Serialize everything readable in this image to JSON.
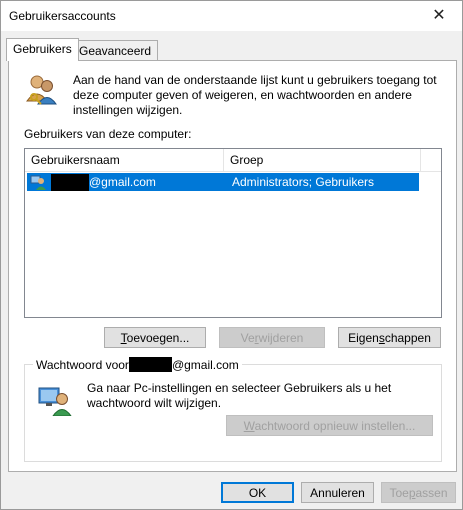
{
  "window": {
    "title": "Gebruikersaccounts",
    "close_glyph": "✕"
  },
  "tabs": [
    {
      "label": "Gebruikers",
      "active": true
    },
    {
      "label": "Geavanceerd",
      "active": false
    }
  ],
  "users_tab": {
    "description": "Aan de hand van de onderstaande lijst kunt u gebruikers toegang tot deze computer geven of weigeren, en wachtwoorden en andere instellingen wijzigen.",
    "list_label": "Gebruikers van deze computer:",
    "columns": [
      "Gebruikersnaam",
      "Groep"
    ],
    "rows": [
      {
        "username": "@gmail.com",
        "group": "Administrators; Gebruikers",
        "selected": true
      }
    ],
    "buttons": {
      "add": {
        "pre": "",
        "acc": "T",
        "post": "oevoegen...",
        "enabled": true
      },
      "remove": {
        "pre": "Ve",
        "acc": "r",
        "post": "wijderen",
        "enabled": false
      },
      "properties": {
        "pre": "Eigen",
        "acc": "s",
        "post": "chappen",
        "enabled": true
      }
    },
    "password_group": {
      "legend_prefix": "Wachtwoord voor",
      "legend_suffix": "@gmail.com",
      "text": "Ga naar Pc-instellingen en selecteer Gebruikers als u het wachtwoord wilt wijzigen.",
      "reset_button": {
        "pre": "",
        "acc": "W",
        "post": "achtwoord opnieuw instellen...",
        "enabled": false
      }
    }
  },
  "footer": {
    "ok": "OK",
    "cancel": "Annuleren",
    "apply": {
      "pre": "Toe",
      "acc": "p",
      "post": "assen",
      "enabled": false
    }
  },
  "icons": [
    "users-icon",
    "user-row-icon",
    "password-user-icon",
    "close-icon"
  ]
}
